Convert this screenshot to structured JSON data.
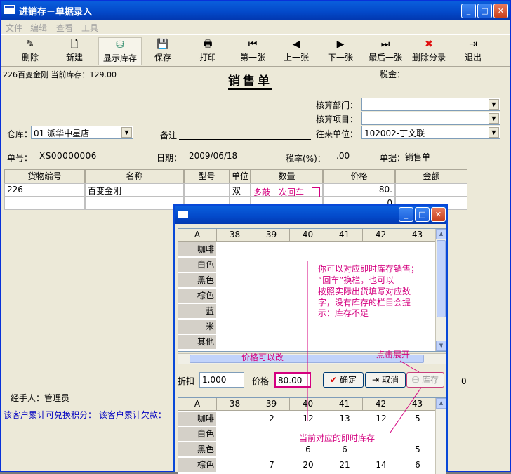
{
  "window": {
    "title": "进销存－单据录入"
  },
  "menu": [
    "文件",
    "编辑",
    "查看",
    "工具"
  ],
  "toolbar": [
    {
      "label": "删除",
      "icon": "✎"
    },
    {
      "label": "新建",
      "icon": "🗋"
    },
    {
      "label": "显示库存",
      "icon": "⛁"
    },
    {
      "label": "保存",
      "icon": "💾"
    },
    {
      "label": "打印",
      "icon": "🖶"
    },
    {
      "label": "第一张",
      "icon": "⏮"
    },
    {
      "label": "上一张",
      "icon": "◀"
    },
    {
      "label": "下一张",
      "icon": "▶"
    },
    {
      "label": "最后一张",
      "icon": "⏭"
    },
    {
      "label": "删除分录",
      "icon": "✖"
    },
    {
      "label": "退出",
      "icon": "⇥"
    }
  ],
  "header": {
    "stock_info": "226百变金刚 当前库存：129.00",
    "doc_title": "销售单",
    "tax_label": "税金："
  },
  "form": {
    "dept_label": "核算部门：",
    "project_label": "核算项目：",
    "warehouse_label": "仓库：",
    "warehouse_value": "01 派华中星店",
    "remark_label": "备注",
    "partner_label": "往来单位：",
    "partner_value": "102002-丁文联",
    "docno_label": "单号：",
    "docno_value": "XS00000006",
    "date_label": "日期：",
    "date_value": "2009/06/18",
    "taxrate_label": "税率(%)：",
    "taxrate_value": ".00",
    "doctype_label": "单据：",
    "doctype_value": "销售单"
  },
  "grid": {
    "headers": [
      "货物编号",
      "名称",
      "型号",
      "单位",
      "数量",
      "价格",
      "金额"
    ],
    "rows": [
      [
        "226",
        "百变金刚",
        "",
        "双",
        "多敲一次回车",
        "80.",
        ""
      ],
      [
        "",
        "",
        "",
        "",
        "",
        "0",
        ""
      ]
    ]
  },
  "footer": {
    "handler_label": "经手人：管理员",
    "points_text": "该客户累计可兑换积分：  该客户累计欠款：",
    "zero_value": "0"
  },
  "popup": {
    "cols": [
      "A",
      "38",
      "39",
      "40",
      "41",
      "42",
      "43"
    ],
    "rows": [
      "咖啡",
      "白色",
      "黑色",
      "棕色",
      "蓝",
      "米",
      "其他"
    ],
    "discount_label": "折扣",
    "discount_value": "1.000",
    "price_label": "价格",
    "price_value": "80.00",
    "ok_label": "确定",
    "cancel_label": "取消",
    "stock_label": "库存",
    "stock_rows": [
      {
        "name": "咖啡",
        "vals": [
          "",
          "2",
          "12",
          "13",
          "12",
          "5"
        ]
      },
      {
        "name": "白色",
        "vals": [
          "",
          "",
          "",
          "",
          "",
          ""
        ]
      },
      {
        "name": "黑色",
        "vals": [
          "",
          "",
          "6",
          "6",
          "",
          "5"
        ]
      },
      {
        "name": "棕色",
        "vals": [
          "",
          "7",
          "20",
          "21",
          "14",
          "6"
        ]
      }
    ]
  },
  "annotations": {
    "note1": "你可以对应即时库存销售；",
    "note2": "“回车”换栏，也可以",
    "note3": "按照实际出货填写对应数",
    "note4": "字，没有库存的栏目会提",
    "note5": "示：库存不足",
    "price_note": "价格可以改",
    "expand_note": "点击展开",
    "stock_note": "当前对应的即时库存"
  },
  "colors": {
    "annotation": "#d4007f",
    "titlebar": "#0349c9",
    "link_text": "#0000c0"
  }
}
